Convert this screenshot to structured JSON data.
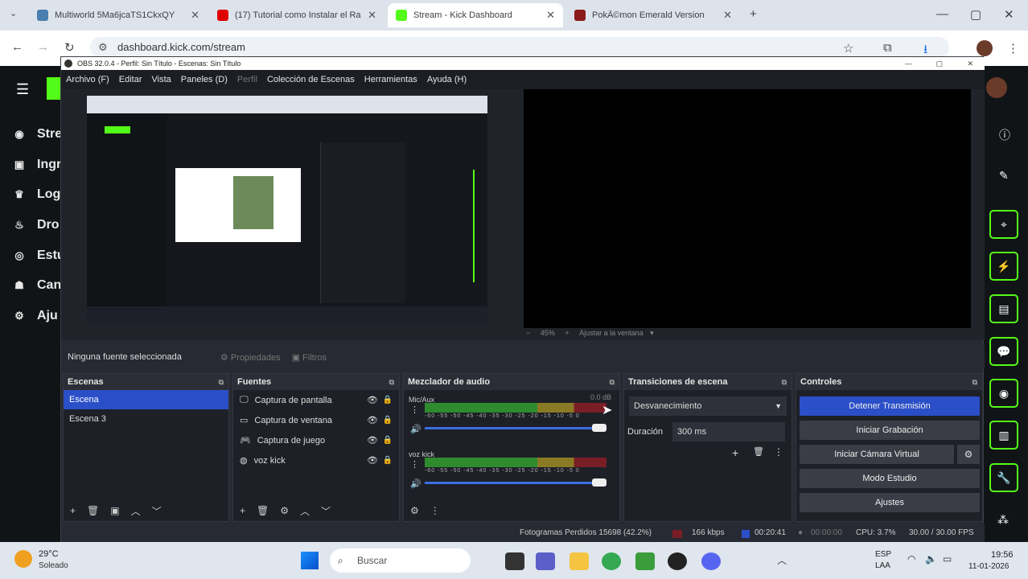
{
  "browser": {
    "tabs": [
      {
        "label": "Multiworld 5Ma6jcaTS1CkxQY",
        "color": "#4a7fb0"
      },
      {
        "label": "(17) Tutorial como Instalar el Ra",
        "color": "#e00000"
      },
      {
        "label": "Stream - Kick Dashboard",
        "color": "#53fc18"
      },
      {
        "label": "PokÃ©mon Emerald Version",
        "color": "#8b1a1a"
      }
    ],
    "url": "dashboard.kick.com/stream"
  },
  "kick": {
    "nav": [
      {
        "label": "Stre",
        "icon": "broadcast-icon"
      },
      {
        "label": "Ingr",
        "icon": "money-icon"
      },
      {
        "label": "Log",
        "icon": "trophy-icon"
      },
      {
        "label": "Dro",
        "icon": "drops-icon"
      },
      {
        "label": "Estu",
        "icon": "studio-icon"
      },
      {
        "label": "Can",
        "icon": "channel-icon"
      },
      {
        "label": "Aju",
        "icon": "gear-icon"
      }
    ]
  },
  "obs": {
    "title": "OBS 32.0.4 - Perfil: Sin Título - Escenas: Sin Título",
    "menu": [
      "Archivo (F)",
      "Editar",
      "Vista",
      "Paneles (D)",
      "Perfil",
      "Colección de Escenas",
      "Herramientas",
      "Ayuda (H)"
    ],
    "zoom": "45%",
    "fit_label": "Ajustar a la ventana",
    "no_source": "Ninguna fuente seleccionada",
    "properties": "Propiedades",
    "filters": "Filtros",
    "scenes_title": "Escenas",
    "scenes": [
      "Escena",
      "Escena 3"
    ],
    "sources_title": "Fuentes",
    "sources": [
      "Captura de pantalla",
      "Captura de ventana",
      "Captura de juego",
      "voz kick"
    ],
    "mixer_title": "Mezclador de audio",
    "mixer": [
      {
        "name": "Mic/Aux",
        "db": "0.0 dB",
        "level": 0.95
      },
      {
        "name": "voz kick",
        "db": "",
        "level": 1.0
      }
    ],
    "ticks": "-60 -55 -50 -45 -40 -35 -30 -25 -20 -15 -10 -5 0",
    "transitions_title": "Transiciones de escena",
    "transition": "Desvanecimiento",
    "duration_label": "Duración",
    "duration": "300 ms",
    "controls_title": "Controles",
    "controls": [
      "Detener Transmisión",
      "Iniciar Grabación",
      "Iniciar Cámara Virtual",
      "Modo Estudio",
      "Ajustes"
    ],
    "status": {
      "dropped": "Fotogramas Perdidos 15698 (42.2%)",
      "bitrate": "166 kbps",
      "live_time": "00:20:41",
      "rec_time": "00:00:00",
      "cpu": "CPU: 3.7%",
      "fps": "30.00 / 30.00 FPS"
    }
  },
  "taskbar": {
    "weather_temp": "29°C",
    "weather_desc": "Soleado",
    "search_placeholder": "Buscar",
    "lang": "ESP",
    "lang2": "LAA",
    "time": "19:56",
    "date": "11-01-2026"
  }
}
